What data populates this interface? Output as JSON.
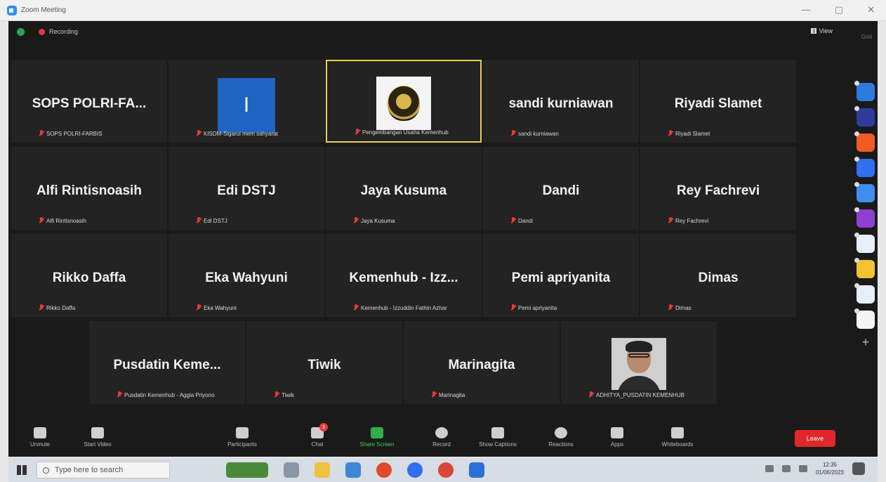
{
  "window": {
    "title": "Zoom Meeting",
    "controls": [
      "—",
      "▢",
      "✕"
    ]
  },
  "topbar": {
    "recording_label": "Recording",
    "view_label": "View",
    "corner_text": "Grid"
  },
  "participants": [
    {
      "display": "SOPS POLRI-FA...",
      "label": "SOPS POLRI-FARBIS",
      "kind": "text"
    },
    {
      "display": "I",
      "label": "KISDM-Sigarui mem sahyarat",
      "kind": "initial"
    },
    {
      "display": "",
      "label": "Pengembangan Usaha Kemenhub",
      "kind": "logo",
      "active": true
    },
    {
      "display": "sandi kurniawan",
      "label": "sandi kurniawan",
      "kind": "text"
    },
    {
      "display": "Riyadi Slamet",
      "label": "Riyadi Slamet",
      "kind": "text"
    },
    {
      "display": "Alfi Rintisnoasih",
      "label": "Alfi Rintisnoasih",
      "kind": "text"
    },
    {
      "display": "Edi DSTJ",
      "label": "Edi DSTJ",
      "kind": "text"
    },
    {
      "display": "Jaya Kusuma",
      "label": "Jaya Kusuma",
      "kind": "text"
    },
    {
      "display": "Dandi",
      "label": "Dandi",
      "kind": "text"
    },
    {
      "display": "Rey Fachrevi",
      "label": "Rey Fachrevi",
      "kind": "text"
    },
    {
      "display": "Rikko Daffa",
      "label": "Rikko Daffa",
      "kind": "text"
    },
    {
      "display": "Eka Wahyuni",
      "label": "Eka Wahyuni",
      "kind": "text"
    },
    {
      "display": "Kemenhub - Izz...",
      "label": "Kemenhub - Izzuddin Fathin Azhar",
      "kind": "text"
    },
    {
      "display": "Pemi apriyanita",
      "label": "Pemi apriyanita",
      "kind": "text"
    },
    {
      "display": "Dimas",
      "label": "Dimas",
      "kind": "text"
    },
    {
      "display": "Pusdatin Keme...",
      "label": "Pusdatin Kemenhub - Aggia Priyono",
      "kind": "text"
    },
    {
      "display": "Tiwik",
      "label": "Tiwik",
      "kind": "text"
    },
    {
      "display": "Marinagita",
      "label": "Marinagita",
      "kind": "text"
    },
    {
      "display": "",
      "label": "ADHITYA_PUSDATIN KEMENHUB",
      "kind": "photo"
    }
  ],
  "toolbar": {
    "unmute": "Unmute",
    "start_video": "Start Video",
    "participants": "Participants",
    "participants_count": "19",
    "chat": "Chat",
    "chat_badge": "3",
    "share_screen": "Share Screen",
    "record": "Record",
    "show_captions": "Show Captions",
    "reactions": "Reactions",
    "apps": "Apps",
    "whiteboards": "Whiteboards",
    "leave": "Leave"
  },
  "taskbar": {
    "search_placeholder": "Type here to search",
    "time": "12:35",
    "date": "01/06/2023"
  },
  "colors": {
    "accent_green": "#2fae4a",
    "leave_red": "#e02828",
    "active_border": "#e6d24a",
    "tile_bg": "#232323"
  }
}
